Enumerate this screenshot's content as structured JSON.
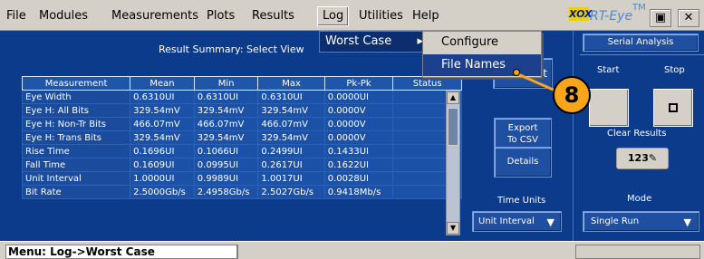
{
  "menu": [
    "File",
    "Modules",
    "Measurements",
    "Plots",
    "Results",
    "Log",
    "Utilities",
    "Help"
  ],
  "brand": {
    "logo": "XOX",
    "name": "RT-Eye",
    "tm": "TM"
  },
  "window": {
    "restore_icon": "restore-icon",
    "close_icon": "close-icon"
  },
  "panel": {
    "title": "Result Summary: Select View"
  },
  "table": {
    "headers": [
      "Measurement",
      "Mean",
      "Min",
      "Max",
      "Pk-Pk",
      "Status"
    ],
    "rows": [
      [
        "Eye Width",
        "0.6310UI",
        "0.6310UI",
        "0.6310UI",
        "0.0000UI",
        ""
      ],
      [
        "Eye H: All Bits",
        "329.54mV",
        "329.54mV",
        "329.54mV",
        "0.0000V",
        ""
      ],
      [
        "Eye H: Non-Tr Bits",
        "466.07mV",
        "466.07mV",
        "466.07mV",
        "0.0000V",
        ""
      ],
      [
        "Eye H: Trans Bits",
        "329.54mV",
        "329.54mV",
        "329.54mV",
        "0.0000V",
        ""
      ],
      [
        "Rise Time",
        "0.1696UI",
        "0.1066UI",
        "0.2499UI",
        "0.1433UI",
        ""
      ],
      [
        "Fall Time",
        "0.1609UI",
        "0.0995UI",
        "0.2617UI",
        "0.1622UI",
        ""
      ],
      [
        "Unit Interval",
        "1.0000UI",
        "0.9989UI",
        "1.0017UI",
        "0.0028UI",
        ""
      ],
      [
        "Bit Rate",
        "2.5000Gb/s",
        "2.4958Gb/s",
        "2.5027Gb/s",
        "0.9418Mb/s",
        ""
      ]
    ]
  },
  "buttons": {
    "export": [
      "Export",
      "To CSV"
    ],
    "details": "Details",
    "time_units_label": "Time Units",
    "time_units_value": "Unit Interval",
    "ok_partial": "t"
  },
  "right_panel": {
    "title": "Serial Analysis",
    "start": "Start",
    "stop": "Stop",
    "clear_results": "Clear Results",
    "mode_label": "Mode",
    "mode_value": "Single Run"
  },
  "dropdown": {
    "worst_case": "Worst Case",
    "configure": "Configure",
    "file_names": "File Names"
  },
  "callout": {
    "number": "8"
  },
  "status": {
    "text": "Menu: Log->Worst Case"
  }
}
